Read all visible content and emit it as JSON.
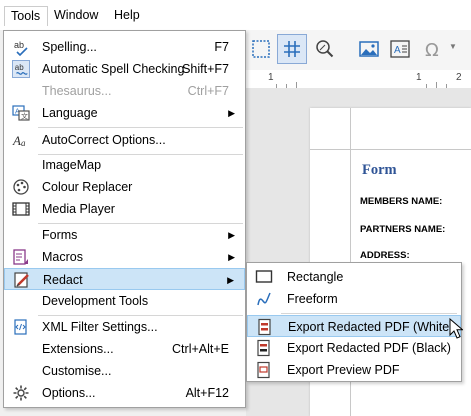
{
  "menubar": {
    "tools": "Tools",
    "window": "Window",
    "help": "Help"
  },
  "tools_menu": {
    "spelling": {
      "label": "Spelling...",
      "shortcut": "F7"
    },
    "auto_spell": {
      "label": "Automatic Spell Checking",
      "shortcut": "Shift+F7"
    },
    "thesaurus": {
      "label": "Thesaurus...",
      "shortcut": "Ctrl+F7"
    },
    "language": {
      "label": "Language"
    },
    "autocorrect": {
      "label": "AutoCorrect Options..."
    },
    "imagemap": {
      "label": "ImageMap"
    },
    "colour_replacer": {
      "label": "Colour Replacer"
    },
    "media_player": {
      "label": "Media Player"
    },
    "forms": {
      "label": "Forms"
    },
    "macros": {
      "label": "Macros"
    },
    "redact": {
      "label": "Redact"
    },
    "dev_tools": {
      "label": "Development Tools"
    },
    "xml_filter": {
      "label": "XML Filter Settings..."
    },
    "extensions": {
      "label": "Extensions...",
      "shortcut": "Ctrl+Alt+E"
    },
    "customise": {
      "label": "Customise..."
    },
    "options": {
      "label": "Options...",
      "shortcut": "Alt+F12"
    }
  },
  "redact_menu": {
    "rectangle": "Rectangle",
    "freeform": "Freeform",
    "export_white": "Export Redacted PDF (White)",
    "export_black": "Export Redacted PDF (Black)",
    "export_preview": "Export Preview PDF"
  },
  "ruler": {
    "mark1": "1",
    "mark2": "1",
    "mark3": "2"
  },
  "document": {
    "title": "Form",
    "members": "MEMBERS NAME:",
    "partners": "PARTNERS NAME:",
    "address": "ADDRESS:"
  },
  "colors": {
    "highlight": "#cce4f7",
    "highlight_border": "#99c9ef",
    "title_blue": "#2f5496",
    "selected_tool": "#dbe7f6"
  },
  "icons": [
    "spelling-icon",
    "auto-spell-icon",
    "language-icon",
    "autocorrect-icon",
    "colour-replacer-icon",
    "media-player-icon",
    "macros-icon",
    "redact-icon",
    "xml-filter-icon",
    "options-icon",
    "rectangle-icon",
    "freeform-icon",
    "export-white-icon",
    "export-black-icon",
    "export-preview-icon"
  ]
}
